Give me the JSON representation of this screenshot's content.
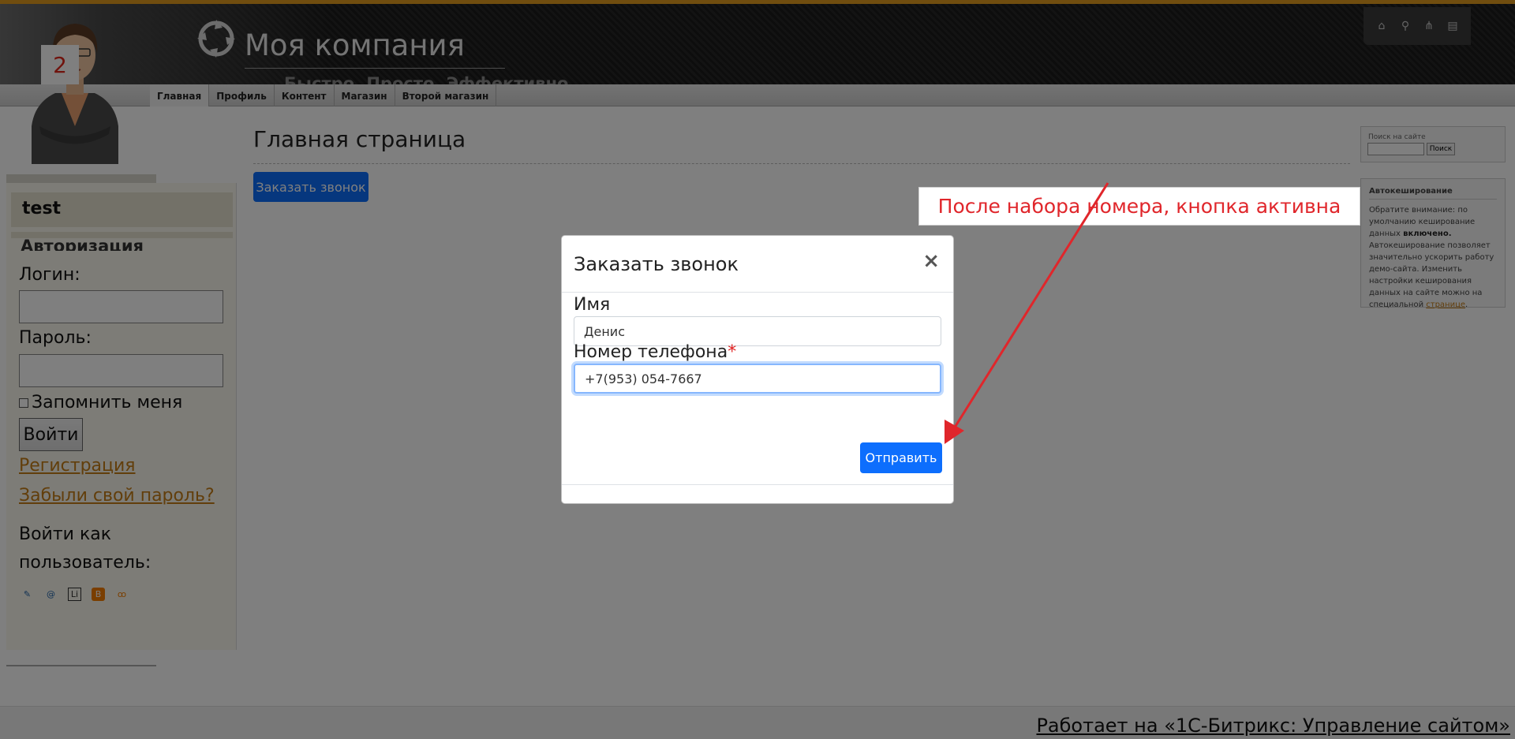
{
  "header": {
    "company_name": "Моя компания",
    "slogan": "Быстро. Просто. Эффективно",
    "quick_icons": [
      "home-icon",
      "search-icon",
      "sitemap-icon",
      "print-icon"
    ]
  },
  "menu": {
    "items": [
      {
        "label": "Главная",
        "active": true
      },
      {
        "label": "Профиль"
      },
      {
        "label": "Контент"
      },
      {
        "label": "Магазин"
      },
      {
        "label": "Второй магазин"
      }
    ]
  },
  "step_badge": "2",
  "sidebar": {
    "user_name": "test",
    "auth_title": "Авторизация",
    "login_label": "Логин:",
    "password_label": "Пароль:",
    "remember_label": "Запомнить меня",
    "login_button": "Войти",
    "register_link": "Регистрация",
    "forgot_link": "Забыли свой пароль?",
    "login_as": "Войти как пользователь:",
    "social_icons": [
      "livejournal-icon",
      "mailru-icon",
      "liveinternet-icon",
      "blogger-icon",
      "openid-icon"
    ]
  },
  "main": {
    "page_title": "Главная страница",
    "call_button": "Заказать звонок"
  },
  "right": {
    "search_label": "Поиск на сайте",
    "search_button": "Поиск",
    "cache_title": "Автокеширование",
    "cache_text_1": "Обратите внимание: по умолчанию кеширование данных ",
    "cache_text_bold": "включено.",
    "cache_text_2": " Автокеширование позволяет значительно ускорить работу демо-сайта. Изменить настройки кеширования данных на сайте можно на специальной ",
    "cache_link": "странице",
    "cache_text_3": "."
  },
  "footer": {
    "powered_by": "Работает на «1С-Битрикс: Управление сайтом»"
  },
  "modal": {
    "title": "Заказать звонок",
    "close": "×",
    "name_label": "Имя",
    "name_value": "Денис",
    "phone_label": "Номер телефона",
    "required_mark": "*",
    "phone_value": "+7(953) 054-7667",
    "submit": "Отправить"
  },
  "annotation": {
    "text": "После набора номера, кнопка активна",
    "color": "#e0262b"
  },
  "colors": {
    "accent_orange": "#e09a1f",
    "primary_blue": "#0d6efd",
    "link_orange": "#c47d16"
  }
}
